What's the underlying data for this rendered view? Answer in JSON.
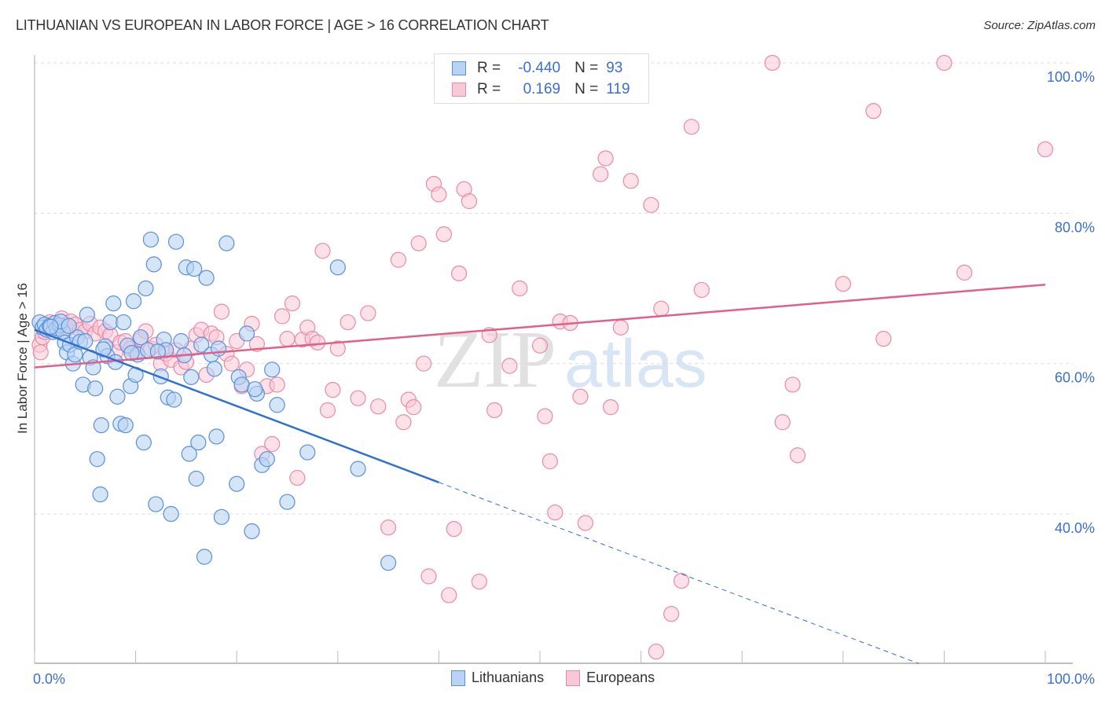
{
  "header": {
    "title": "LITHUANIAN VS EUROPEAN IN LABOR FORCE | AGE > 16 CORRELATION CHART",
    "source": "Source: ZipAtlas.com"
  },
  "legend": {
    "rows": [
      {
        "r_label": "R =",
        "r_value": "-0.440",
        "n_label": "N =",
        "n_value": "93"
      },
      {
        "r_label": "R =",
        "r_value": "0.169",
        "n_label": "N =",
        "n_value": "119"
      }
    ],
    "bottom": [
      "Lithuanians",
      "Europeans"
    ]
  },
  "watermark": {
    "zip": "ZIP",
    "atlas": "atlas"
  },
  "colors": {
    "lithuanians_fill": "#b8d3f4",
    "lithuanians_stroke": "#5b8fd9",
    "lithuanians_line": "#2f6fd1",
    "europeans_fill": "#f9c8d7",
    "europeans_stroke": "#e88aa8",
    "europeans_line": "#e0608a",
    "tick_text": "#3b6fcf"
  },
  "chart_data": {
    "type": "scatter",
    "title": "LITHUANIAN VS EUROPEAN IN LABOR FORCE | AGE > 16 CORRELATION CHART",
    "xlabel": "",
    "ylabel": "In Labor Force | Age > 16",
    "xlim": [
      0,
      100
    ],
    "ylim": [
      20,
      102
    ],
    "x_tick_labels": [
      "0.0%",
      "100.0%"
    ],
    "y_ticks": [
      40,
      60,
      80,
      100
    ],
    "y_tick_labels": [
      "40.0%",
      "60.0%",
      "80.0%",
      "100.0%"
    ],
    "grid": true,
    "legend_position": "top-center",
    "series": [
      {
        "name": "Lithuanians",
        "R": -0.44,
        "N": 93,
        "trend": {
          "x0": 0,
          "y0": 64.5,
          "x1": 40,
          "y1": 44.2,
          "dashed_to_x": 100
        },
        "points": [
          [
            0.5,
            65.5
          ],
          [
            0.8,
            64.8
          ],
          [
            1,
            65.2
          ],
          [
            1.2,
            64.5
          ],
          [
            1.5,
            65
          ],
          [
            1.8,
            64.2
          ],
          [
            2,
            65.4
          ],
          [
            2.2,
            64.7
          ],
          [
            2.5,
            65.1
          ],
          [
            2.8,
            64.3
          ],
          [
            3,
            62.8
          ],
          [
            3.2,
            61.5
          ],
          [
            3.5,
            62.5
          ],
          [
            3.8,
            60
          ],
          [
            4,
            61.2
          ],
          [
            4.2,
            63.5
          ],
          [
            4.5,
            62.9
          ],
          [
            4.8,
            57.2
          ],
          [
            5,
            63
          ],
          [
            5.2,
            66.5
          ],
          [
            5.5,
            60.8
          ],
          [
            5.8,
            59.5
          ],
          [
            6,
            56.7
          ],
          [
            6.2,
            47.3
          ],
          [
            6.5,
            42.6
          ],
          [
            6.6,
            51.8
          ],
          [
            7,
            62.3
          ],
          [
            7.2,
            61
          ],
          [
            7.5,
            65.5
          ],
          [
            7.8,
            68
          ],
          [
            8,
            60.2
          ],
          [
            8.2,
            55.6
          ],
          [
            8.5,
            52
          ],
          [
            8.8,
            65.5
          ],
          [
            9,
            51.8
          ],
          [
            9.2,
            62.4
          ],
          [
            9.5,
            57
          ],
          [
            9.8,
            68.3
          ],
          [
            10,
            58.5
          ],
          [
            10.2,
            61.2
          ],
          [
            10.5,
            63.5
          ],
          [
            10.8,
            49.5
          ],
          [
            11,
            70
          ],
          [
            11.2,
            61.8
          ],
          [
            11.5,
            76.5
          ],
          [
            11.8,
            73.2
          ],
          [
            12,
            41.3
          ],
          [
            12.5,
            58.3
          ],
          [
            12.8,
            63.2
          ],
          [
            13,
            61.8
          ],
          [
            13.2,
            55.5
          ],
          [
            13.5,
            40
          ],
          [
            13.8,
            55.2
          ],
          [
            14,
            76.2
          ],
          [
            14.5,
            63
          ],
          [
            15,
            72.8
          ],
          [
            15.3,
            48
          ],
          [
            15.5,
            58.2
          ],
          [
            15.8,
            72.6
          ],
          [
            16,
            44.7
          ],
          [
            16.2,
            49.5
          ],
          [
            16.5,
            62.5
          ],
          [
            16.8,
            34.3
          ],
          [
            17,
            71.4
          ],
          [
            17.5,
            61.2
          ],
          [
            17.8,
            59.3
          ],
          [
            18,
            50.3
          ],
          [
            18.5,
            39.6
          ],
          [
            19,
            76
          ],
          [
            20,
            44
          ],
          [
            20.2,
            58.2
          ],
          [
            20.5,
            57.2
          ],
          [
            21,
            64
          ],
          [
            21.5,
            37.7
          ],
          [
            22,
            56
          ],
          [
            22.5,
            46.5
          ],
          [
            23,
            47.3
          ],
          [
            23.5,
            59.2
          ],
          [
            24,
            54.5
          ],
          [
            25,
            41.6
          ],
          [
            27,
            48.2
          ],
          [
            30,
            72.8
          ],
          [
            32,
            46
          ],
          [
            35,
            33.5
          ],
          [
            2.6,
            65.6
          ],
          [
            3.4,
            65
          ],
          [
            1.6,
            64.9
          ],
          [
            6.8,
            61.9
          ],
          [
            9.6,
            61.4
          ],
          [
            12.2,
            61.6
          ],
          [
            14.8,
            61.1
          ],
          [
            18.2,
            62
          ],
          [
            21.8,
            56.6
          ]
        ]
      },
      {
        "name": "Europeans",
        "R": 0.169,
        "N": 119,
        "trend": {
          "x0": 0,
          "y0": 59.5,
          "x1": 100,
          "y1": 70.5
        },
        "points": [
          [
            0.5,
            62.5
          ],
          [
            0.8,
            63.5
          ],
          [
            1,
            64.2
          ],
          [
            1.5,
            65.5
          ],
          [
            2,
            64.8
          ],
          [
            2.3,
            65.2
          ],
          [
            2.7,
            66
          ],
          [
            3,
            65.1
          ],
          [
            3.3,
            64.7
          ],
          [
            3.6,
            65.6
          ],
          [
            4,
            65.2
          ],
          [
            4.5,
            64.5
          ],
          [
            5,
            64.3
          ],
          [
            5.5,
            65.3
          ],
          [
            6,
            64
          ],
          [
            6.5,
            64.8
          ],
          [
            7,
            64.3
          ],
          [
            7.5,
            63.8
          ],
          [
            8,
            61.5
          ],
          [
            8.5,
            62.8
          ],
          [
            9,
            63
          ],
          [
            9.5,
            62
          ],
          [
            10,
            61.5
          ],
          [
            10.5,
            63.2
          ],
          [
            11,
            64.3
          ],
          [
            11.5,
            62
          ],
          [
            12,
            62.5
          ],
          [
            12.5,
            60
          ],
          [
            13,
            61.3
          ],
          [
            13.5,
            60.5
          ],
          [
            14,
            61.8
          ],
          [
            14.5,
            59.5
          ],
          [
            15,
            60.2
          ],
          [
            15.5,
            62
          ],
          [
            16,
            63.8
          ],
          [
            16.5,
            64.5
          ],
          [
            17,
            58.5
          ],
          [
            17.5,
            64
          ],
          [
            18,
            63.5
          ],
          [
            18.5,
            66.9
          ],
          [
            19,
            61.3
          ],
          [
            19.5,
            60
          ],
          [
            20,
            63
          ],
          [
            20.5,
            57
          ],
          [
            21,
            59.2
          ],
          [
            21.5,
            65.3
          ],
          [
            22,
            62.6
          ],
          [
            22.5,
            48
          ],
          [
            23,
            57
          ],
          [
            23.5,
            49.3
          ],
          [
            24,
            57.2
          ],
          [
            24.5,
            66.3
          ],
          [
            25,
            63.3
          ],
          [
            25.5,
            68
          ],
          [
            26,
            44.8
          ],
          [
            26.5,
            63.2
          ],
          [
            27,
            64.8
          ],
          [
            27.5,
            63.3
          ],
          [
            28,
            62.8
          ],
          [
            28.5,
            75
          ],
          [
            29,
            53.8
          ],
          [
            29.5,
            56.5
          ],
          [
            30,
            62
          ],
          [
            31,
            65.5
          ],
          [
            32,
            55.4
          ],
          [
            33,
            66.7
          ],
          [
            34,
            54.3
          ],
          [
            35,
            38.2
          ],
          [
            36,
            73.8
          ],
          [
            36.5,
            52.2
          ],
          [
            37,
            55.2
          ],
          [
            37.5,
            54.2
          ],
          [
            38,
            76
          ],
          [
            38.5,
            60
          ],
          [
            39,
            31.7
          ],
          [
            39.5,
            83.9
          ],
          [
            40,
            82.5
          ],
          [
            40.5,
            77.2
          ],
          [
            41,
            29.2
          ],
          [
            41.5,
            38
          ],
          [
            42,
            72
          ],
          [
            42.5,
            83.2
          ],
          [
            43,
            81.6
          ],
          [
            44,
            31
          ],
          [
            45,
            63.8
          ],
          [
            45.5,
            53.8
          ],
          [
            47,
            59.7
          ],
          [
            48,
            70
          ],
          [
            50,
            62.4
          ],
          [
            50.5,
            53
          ],
          [
            51,
            47
          ],
          [
            51.5,
            40.2
          ],
          [
            52,
            65.6
          ],
          [
            53,
            65.4
          ],
          [
            54,
            55.6
          ],
          [
            54.5,
            38.8
          ],
          [
            56,
            85.2
          ],
          [
            56.5,
            87.3
          ],
          [
            57,
            54.2
          ],
          [
            58,
            64.8
          ],
          [
            59,
            84.3
          ],
          [
            61,
            81.1
          ],
          [
            61.5,
            21.7
          ],
          [
            62,
            67.3
          ],
          [
            63,
            26.7
          ],
          [
            64,
            31.1
          ],
          [
            65,
            91.5
          ],
          [
            66,
            69.8
          ],
          [
            73,
            100
          ],
          [
            74,
            52.2
          ],
          [
            75,
            57.2
          ],
          [
            75.5,
            47.8
          ],
          [
            80,
            70.6
          ],
          [
            83,
            93.6
          ],
          [
            84,
            63.3
          ],
          [
            90,
            100
          ],
          [
            92,
            72.1
          ],
          [
            100,
            88.5
          ],
          [
            0.6,
            61.5
          ]
        ]
      }
    ]
  }
}
